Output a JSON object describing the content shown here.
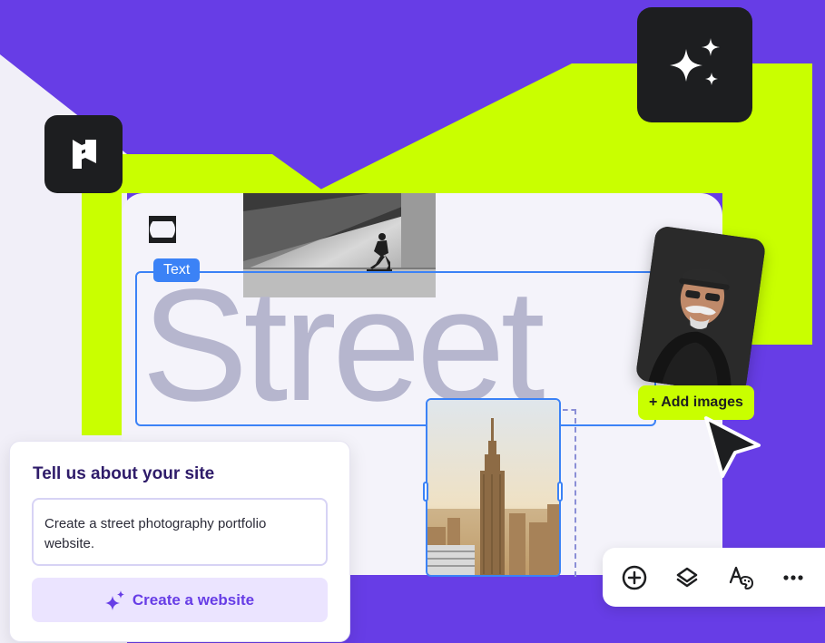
{
  "colors": {
    "brand_purple": "#673de6",
    "lime": "#c9ff00",
    "badge_dark": "#1d1e20",
    "selection_blue": "#3b82f6",
    "card_bg": "#f4f3fa",
    "street_text": "#b6b6ce"
  },
  "editor": {
    "text_tag": "Text",
    "headline": "Street",
    "add_images_label": "+ Add images"
  },
  "site_panel": {
    "title": "Tell us about your site",
    "prompt_value": "Create a street photography portfolio website.",
    "create_button_label": "Create a website"
  },
  "toolbar": {
    "items": [
      "plus-circle-icon",
      "layers-icon",
      "palette-text-icon",
      "more-icon"
    ]
  },
  "icons": {
    "logo": "hostinger-logo-icon",
    "ai": "sparkles-icon",
    "cursor": "pointer-cursor-icon"
  }
}
